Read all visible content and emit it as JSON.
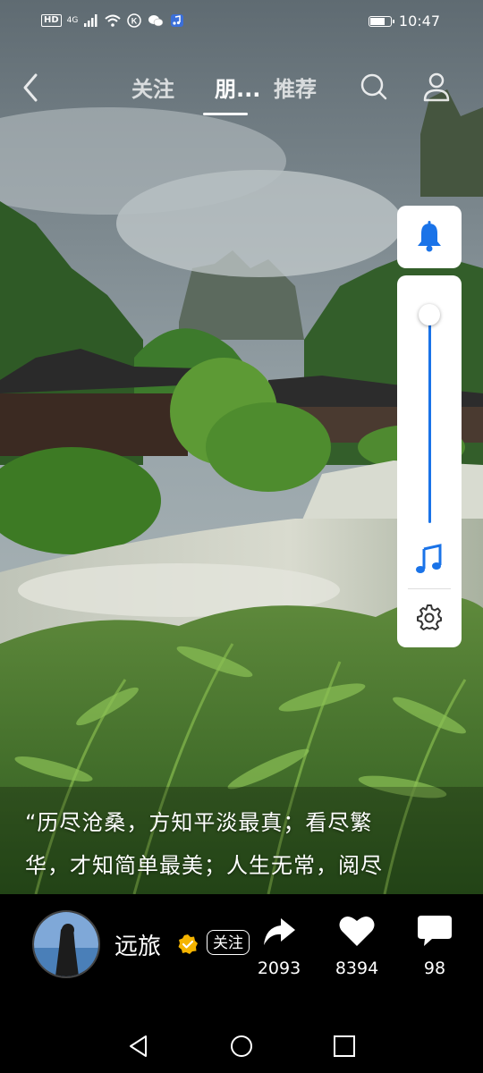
{
  "status_bar": {
    "network_badge": "HD",
    "network_type": "4G",
    "time": "10:47",
    "battery_level": 0.8,
    "icons": [
      "signal-icon",
      "wifi-icon",
      "k-app-icon",
      "wechat-icon",
      "music-app-icon",
      "battery-icon"
    ]
  },
  "top_nav": {
    "tabs": [
      {
        "label": "关注",
        "active": false
      },
      {
        "label": "朋...",
        "active": true
      },
      {
        "label": "推荐",
        "active": false
      }
    ],
    "icons": [
      "back-icon",
      "search-icon",
      "user-icon"
    ]
  },
  "side_panel": {
    "volume_level": 1.0,
    "icons": [
      "bell-icon",
      "music-note-icon",
      "gear-icon"
    ],
    "accent_color": "#1a73e8"
  },
  "caption": {
    "line1": "“历尽沧桑，方知平淡最真；看尽繁",
    "line2": "华，才知简单最美；人生无常，阅尽"
  },
  "author": {
    "name": "远旅",
    "follow_label": "关注",
    "verified_color": "#f5b400"
  },
  "actions": {
    "share_count": "2093",
    "like_count": "8394",
    "comment_count": "98"
  },
  "system_nav": {
    "icons": [
      "back-triangle-icon",
      "home-circle-icon",
      "recents-square-icon"
    ]
  }
}
